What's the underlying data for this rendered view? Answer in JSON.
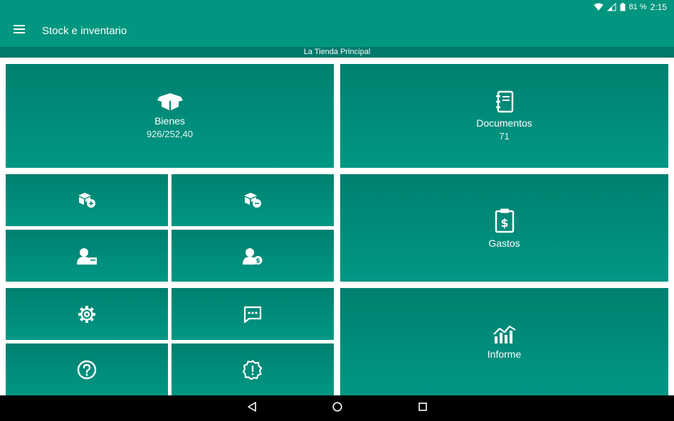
{
  "status_bar": {
    "battery": "81 %",
    "time": "2:15"
  },
  "app_bar": {
    "title": "Stock e inventario",
    "menu_icon": "menu-icon"
  },
  "store": {
    "name": "La Tienda Principal"
  },
  "tiles": {
    "bienes": {
      "label": "Bienes",
      "value": "926/252,40",
      "icon": "box-icon"
    },
    "documentos": {
      "label": "Documentos",
      "value": "71",
      "icon": "notebook-icon"
    },
    "gastos": {
      "label": "Gastos",
      "icon": "clipboard-dollar-icon"
    },
    "informe": {
      "label": "Informe",
      "icon": "chart-icon"
    },
    "small": [
      {
        "icon": "box-add-icon"
      },
      {
        "icon": "box-remove-icon"
      },
      {
        "icon": "supplier-icon"
      },
      {
        "icon": "customer-money-icon"
      },
      {
        "icon": "gear-icon"
      },
      {
        "icon": "chat-icon"
      },
      {
        "icon": "help-icon"
      },
      {
        "icon": "alert-icon"
      }
    ]
  },
  "colors": {
    "primary": "#00967f",
    "dark": "#00796b",
    "tile_top": "#00806f",
    "tile_bottom": "#009784"
  }
}
